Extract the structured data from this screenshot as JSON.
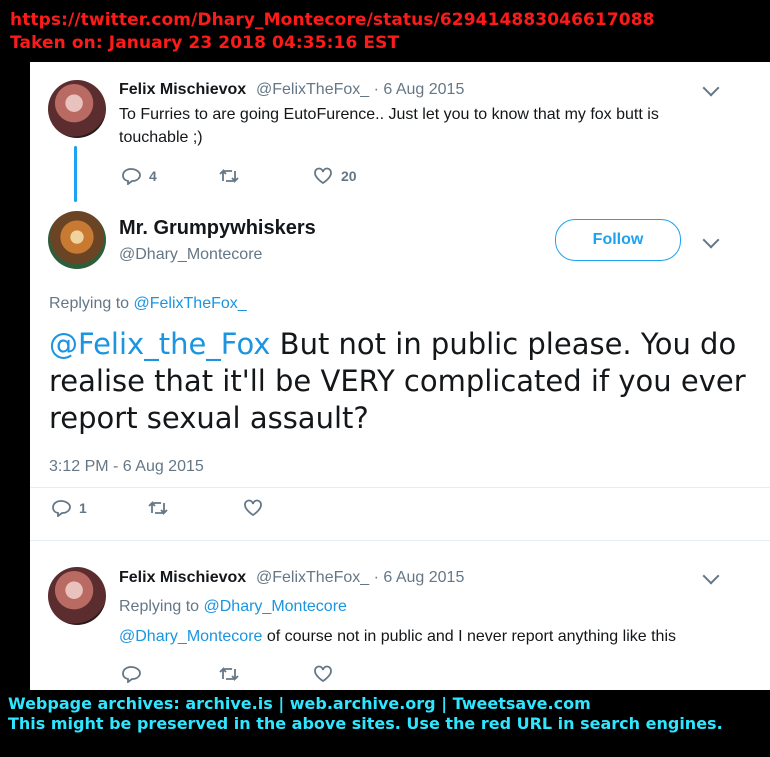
{
  "archive_header": {
    "url": "https://twitter.com/Dhary_Montecore/status/629414883046617088",
    "taken_on": "Taken on:  January 23 2018  04:35:16  EST"
  },
  "tweet1": {
    "name": "Felix Mischievox",
    "handle_date": "@FelixTheFox_ · 6 Aug 2015",
    "text": "To Furries to are going EutoFurence.. Just let you to know that my fox butt is touchable ;)",
    "replies": "4",
    "likes": "20"
  },
  "main_tweet": {
    "name": "Mr. Grumpywhiskers",
    "handle": "@Dhary_Montecore",
    "follow_label": "Follow",
    "replying_prefix": "Replying to ",
    "replying_to": "@FelixTheFox_",
    "mention": "@Felix_the_Fox",
    "text": " But not in public please. You do realise that it'll be VERY complicated if you ever report sexual assault?",
    "timestamp": "3:12 PM - 6 Aug 2015",
    "replies": "1"
  },
  "tweet3": {
    "name": "Felix Mischievox",
    "handle_date": "@FelixTheFox_ · 6 Aug 2015",
    "replying_prefix": "Replying to ",
    "replying_to": "@Dhary_Montecore",
    "mention": "@Dhary_Montecore",
    "text": " of course not in public and I never report anything like this"
  },
  "footer": {
    "line1": "Webpage archives:  archive.is | web.archive.org | Tweetsave.com",
    "line2": "This might be preserved in the above sites. Use the red URL in search engines."
  },
  "icons": {
    "reply": "reply-icon",
    "retweet": "retweet-icon",
    "like": "heart-icon",
    "more": "chevron-down-icon"
  },
  "colors": {
    "header_red": "#ff1a1a",
    "footer_cyan": "#2ee6ff",
    "twitter_blue": "#1da1f2"
  }
}
